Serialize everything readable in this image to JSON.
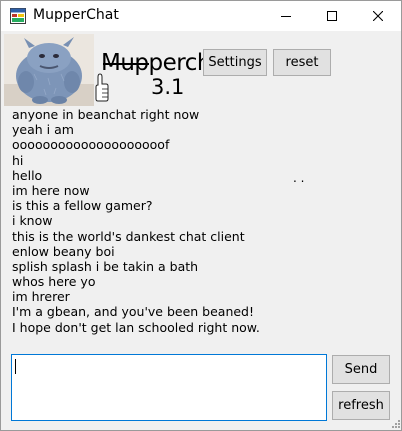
{
  "window": {
    "title": "MupperChat",
    "controls": [
      "minimize-icon",
      "maximize-icon",
      "close-icon"
    ]
  },
  "logo": {
    "brand": "Mupperchat",
    "version": "3.1"
  },
  "toolbar": {
    "settings_label": "Settings",
    "reset_label": "reset"
  },
  "chat": {
    "messages": [
      "anyone in beanchat right now",
      "yeah i am",
      "oooooooooooooooooooof",
      "hi",
      "hello",
      "im here now",
      "is this a fellow gamer?",
      "i know",
      "this is the world's dankest chat client",
      "enlow beany boi",
      "splish splash i be takin a bath",
      "whos here yo",
      "im hrerer",
      "I'm a gbean, and you've been beaned!",
      "I hope don't get lan schooled right now."
    ],
    "stray": ". ."
  },
  "composer": {
    "value": "",
    "send_label": "Send",
    "refresh_label": "refresh"
  },
  "colors": {
    "input_border": "#0078d7",
    "button_bg": "#e1e1e1",
    "window_bg": "#f0f0f0"
  }
}
